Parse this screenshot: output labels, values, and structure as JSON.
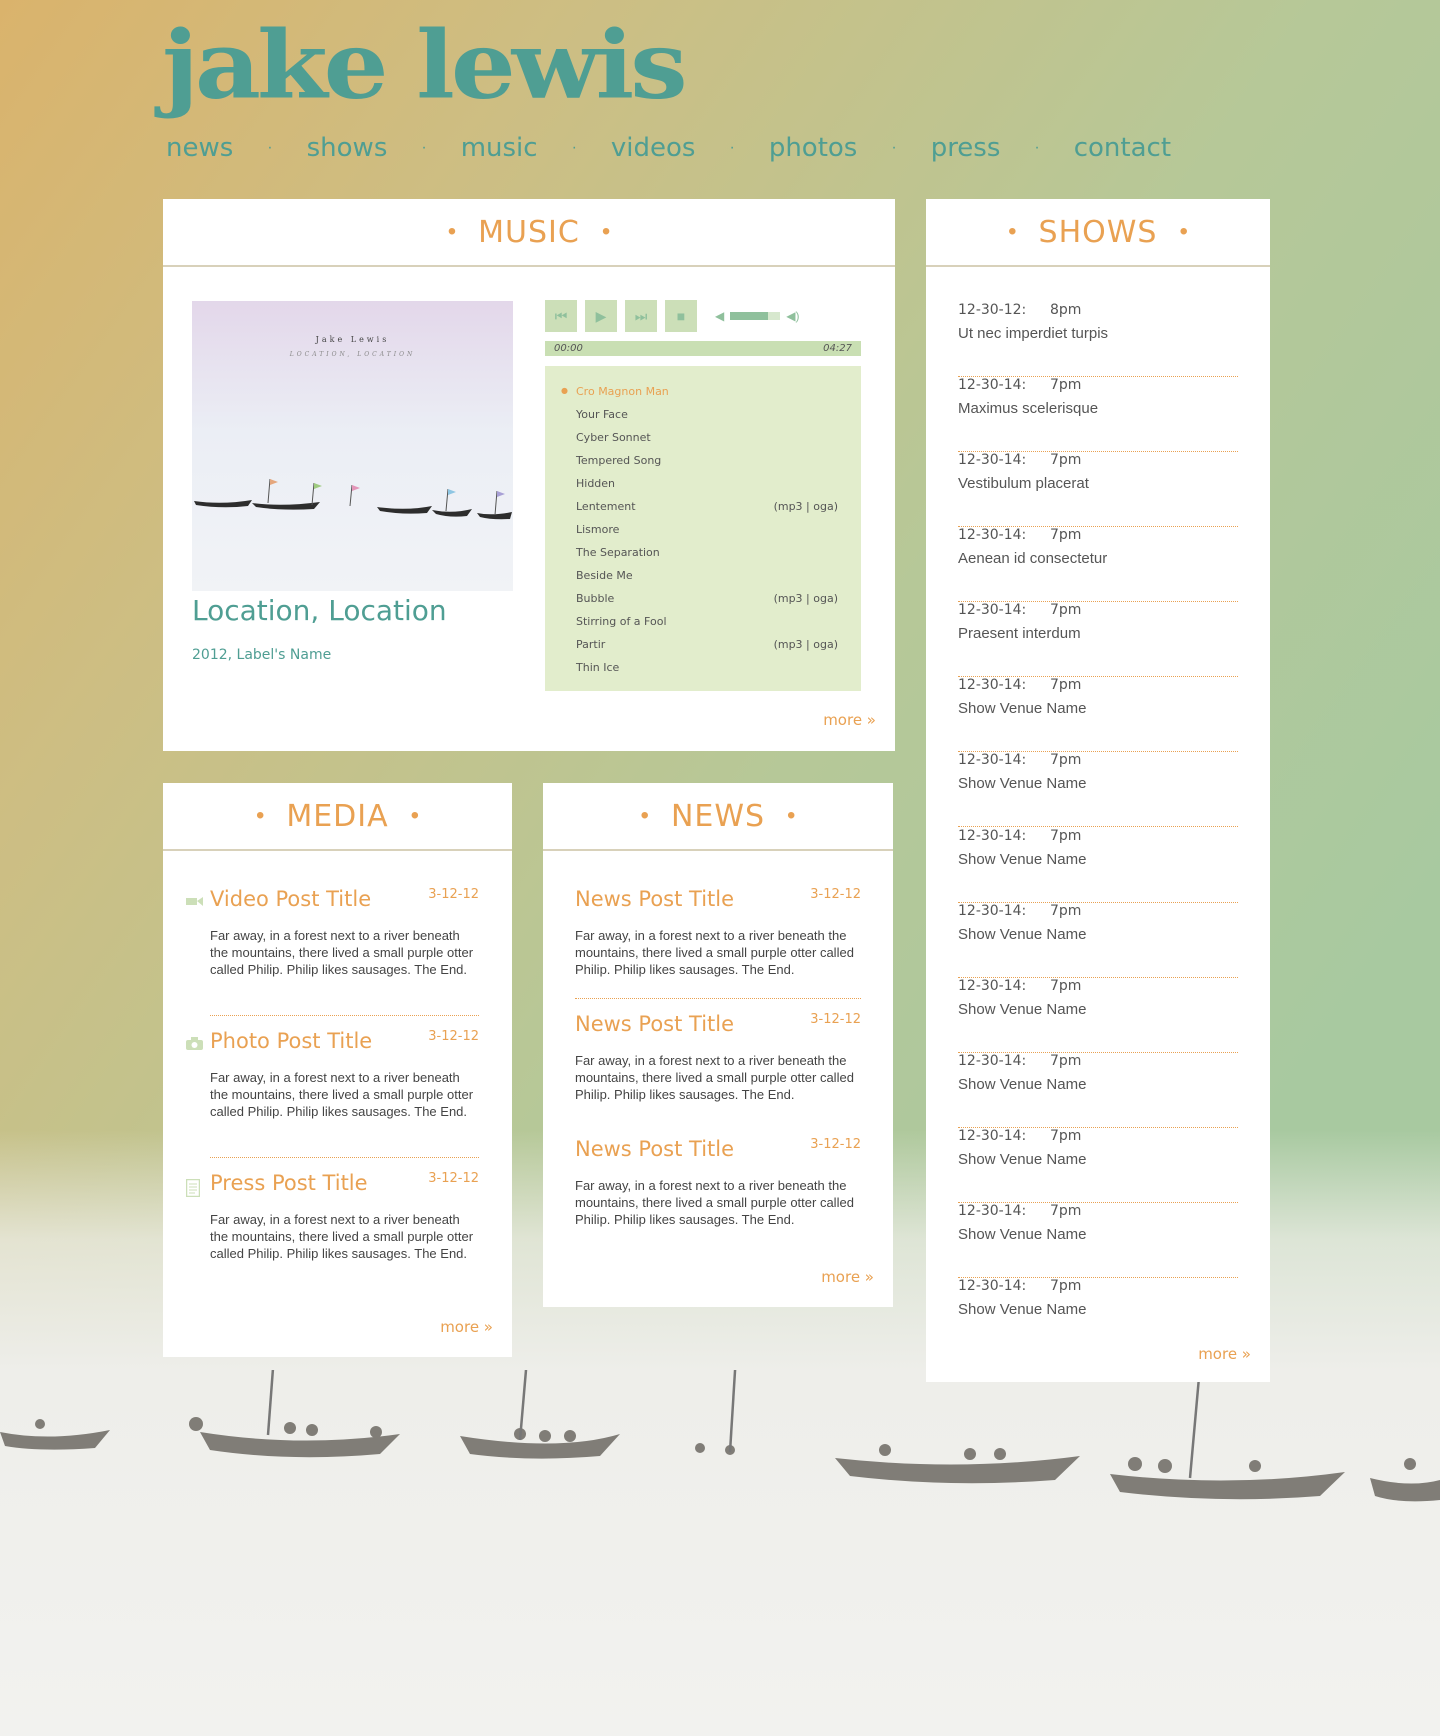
{
  "brand": {
    "logo": "jake lewis"
  },
  "nav": [
    "news",
    "shows",
    "music",
    "videos",
    "photos",
    "press",
    "contact"
  ],
  "music": {
    "title": "MUSIC",
    "cover": {
      "artist": "Jake Lewis",
      "subtitle": "LOCATION, LOCATION"
    },
    "album_title": "Location, Location",
    "album_info": "2012, Label's Name",
    "player": {
      "controls": {
        "prev": "⏮",
        "play": "▶",
        "next": "⏭",
        "stop": "■"
      },
      "volume": 0.75,
      "time_current": "00:00",
      "time_total": "04:27"
    },
    "tracks": [
      {
        "name": "Cro Magnon Man",
        "formats": "",
        "current": true
      },
      {
        "name": "Your Face",
        "formats": ""
      },
      {
        "name": "Cyber Sonnet",
        "formats": ""
      },
      {
        "name": "Tempered Song",
        "formats": ""
      },
      {
        "name": "Hidden",
        "formats": ""
      },
      {
        "name": "Lentement",
        "formats": "(mp3 | oga)"
      },
      {
        "name": "Lismore",
        "formats": ""
      },
      {
        "name": "The Separation",
        "formats": ""
      },
      {
        "name": "Beside Me",
        "formats": ""
      },
      {
        "name": "Bubble",
        "formats": "(mp3 | oga)"
      },
      {
        "name": "Stirring of a Fool",
        "formats": ""
      },
      {
        "name": "Partir",
        "formats": "(mp3 | oga)"
      },
      {
        "name": "Thin Ice",
        "formats": ""
      }
    ],
    "more": "more »"
  },
  "shows": {
    "title": "SHOWS",
    "items": [
      {
        "date": "12-30-12:",
        "time": "8pm",
        "venue": "Ut nec imperdiet turpis"
      },
      {
        "date": "12-30-14:",
        "time": "7pm",
        "venue": "Maximus scelerisque"
      },
      {
        "date": "12-30-14:",
        "time": "7pm",
        "venue": "Vestibulum placerat"
      },
      {
        "date": "12-30-14:",
        "time": "7pm",
        "venue": "Aenean id consectetur"
      },
      {
        "date": "12-30-14:",
        "time": "7pm",
        "venue": "Praesent interdum"
      },
      {
        "date": "12-30-14:",
        "time": "7pm",
        "venue": "Show Venue Name"
      },
      {
        "date": "12-30-14:",
        "time": "7pm",
        "venue": "Show Venue Name"
      },
      {
        "date": "12-30-14:",
        "time": "7pm",
        "venue": "Show Venue Name"
      },
      {
        "date": "12-30-14:",
        "time": "7pm",
        "venue": "Show Venue Name"
      },
      {
        "date": "12-30-14:",
        "time": "7pm",
        "venue": "Show Venue Name"
      },
      {
        "date": "12-30-14:",
        "time": "7pm",
        "venue": "Show Venue Name"
      },
      {
        "date": "12-30-14:",
        "time": "7pm",
        "venue": "Show Venue Name"
      },
      {
        "date": "12-30-14:",
        "time": "7pm",
        "venue": "Show Venue Name"
      },
      {
        "date": "12-30-14:",
        "time": "7pm",
        "venue": "Show Venue Name"
      }
    ],
    "more": "more »"
  },
  "media": {
    "title": "MEDIA",
    "posts": [
      {
        "icon": "video-icon",
        "title": "Video Post Title",
        "date": "3-12-12",
        "body": "Far away, in a forest next to a river beneath the mountains, there lived a small purple otter called Philip. Philip likes sausages. The End."
      },
      {
        "icon": "camera-icon",
        "title": "Photo Post Title",
        "date": "3-12-12",
        "body": "Far away, in a forest next to a river beneath the mountains, there lived a small purple otter called Philip. Philip likes sausages. The End."
      },
      {
        "icon": "document-icon",
        "title": "Press Post Title",
        "date": "3-12-12",
        "body": "Far away, in a forest next to a river beneath the mountains, there lived a small purple otter called Philip. Philip likes sausages. The End."
      }
    ],
    "more": "more »"
  },
  "news": {
    "title": "NEWS",
    "posts": [
      {
        "title": "News Post Title",
        "date": "3-12-12",
        "body": "Far away, in a forest next to a river beneath the mountains, there lived a small purple otter called Philip. Philip likes sausages. The End."
      },
      {
        "title": "News Post Title",
        "date": "3-12-12",
        "body": "Far away, in a forest next to a river beneath the mountains, there lived a small purple otter called Philip. Philip likes sausages. The End."
      },
      {
        "title": "News Post Title",
        "date": "3-12-12",
        "body": "Far away, in a forest next to a river beneath the mountains, there lived a small purple otter called Philip. Philip likes sausages. The End."
      }
    ],
    "more": "more »"
  },
  "colors": {
    "teal": "#4f9e93",
    "orange": "#e9a152",
    "player_green": "#ccdfb8",
    "playlist_bg": "#e2edcc"
  }
}
